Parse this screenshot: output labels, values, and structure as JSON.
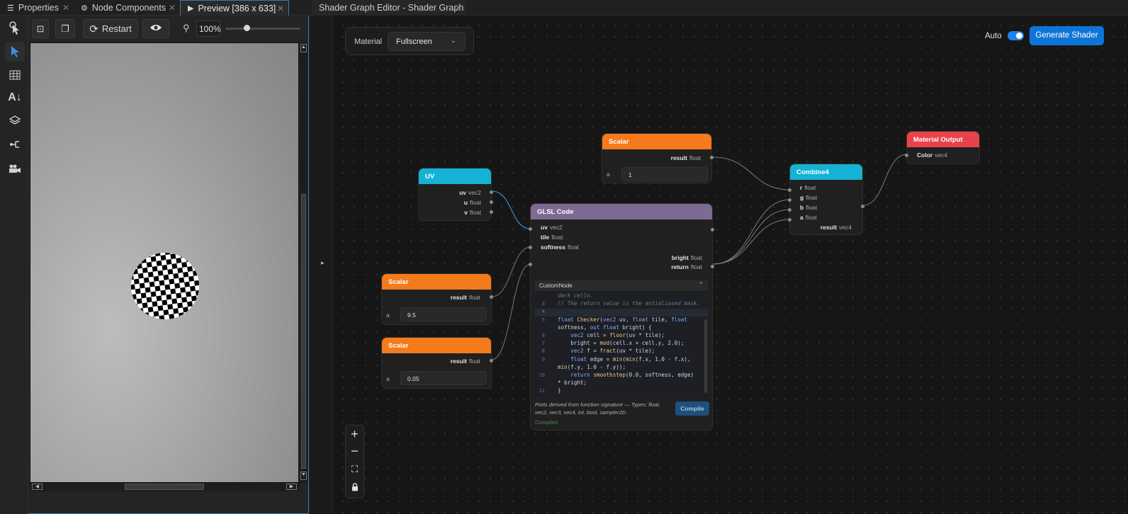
{
  "tabs": [
    {
      "label": "Properties"
    },
    {
      "label": "Node Components"
    },
    {
      "label": "Preview [386 x 633]"
    },
    {
      "label": "Shader Graph Editor - Shader Graph"
    }
  ],
  "preview": {
    "restart_label": "Restart",
    "zoom": "100%",
    "zoom_level": 0.28
  },
  "graph": {
    "material_label": "Material",
    "material_value": "Fullscreen",
    "auto_label": "Auto",
    "auto_on": true,
    "generate_label": "Generate Shader",
    "collapse_arrow": "▸"
  },
  "nodes": {
    "uv": {
      "title": "UV",
      "ports": [
        [
          "uv",
          "vec2"
        ],
        [
          "u",
          "float"
        ],
        [
          "v",
          "float"
        ]
      ]
    },
    "scalar_top": {
      "title": "Scalar",
      "out": [
        "result",
        "float"
      ],
      "field_label": "a",
      "value": "1"
    },
    "scalar_mid": {
      "title": "Scalar",
      "out": [
        "result",
        "float"
      ],
      "field_label": "a",
      "value": "9.5"
    },
    "scalar_bot": {
      "title": "Scalar",
      "out": [
        "result",
        "float"
      ],
      "field_label": "a",
      "value": "0.05"
    },
    "glsl": {
      "title": "GLSL Code",
      "inputs": [
        [
          "uv",
          "vec2"
        ],
        [
          "tile",
          "float"
        ],
        [
          "softness",
          "float"
        ]
      ],
      "outputs": [
        [
          "bright",
          "float"
        ],
        [
          "return",
          "float"
        ]
      ],
      "editor_name": "CustomNode",
      "code_lines": [
        {
          "n": "",
          "text": "dark cells."
        },
        {
          "n": "3",
          "text": "// The return value is the antialiased mask."
        },
        {
          "n": "4",
          "text": ""
        },
        {
          "n": "5",
          "text": "float Checker(vec2 uv, float tile, float"
        },
        {
          "n": "",
          "text": "softness, out float bright) {"
        },
        {
          "n": "6",
          "text": "    vec2 cell = floor(uv * tile);"
        },
        {
          "n": "7",
          "text": "    bright = mod(cell.x + cell.y, 2.0);"
        },
        {
          "n": "8",
          "text": "    vec2 f = fract(uv * tile);"
        },
        {
          "n": "9",
          "text": "    float edge = min(min(f.x, 1.0 - f.x),"
        },
        {
          "n": "",
          "text": "min(f.y, 1.0 - f.y));"
        },
        {
          "n": "10",
          "text": "    return smoothstep(0.0, softness, edge)"
        },
        {
          "n": "",
          "text": "* bright;"
        },
        {
          "n": "11",
          "text": "}"
        }
      ],
      "hint": "Ports derived from function signature — Types: float, vec2, vec3, vec4, int, bool, sampler2D",
      "compile_label": "Compile",
      "status": "Compiled"
    },
    "combine": {
      "title": "Combine4",
      "inputs": [
        [
          "r",
          "float"
        ],
        [
          "g",
          "float"
        ],
        [
          "b",
          "float"
        ],
        [
          "a",
          "float"
        ]
      ],
      "out": [
        "result",
        "vec4"
      ]
    },
    "output": {
      "title": "Material Output",
      "inputs": [
        [
          "Color",
          "vec4"
        ]
      ]
    }
  },
  "colors": {
    "accent": "#0e74d8",
    "orange": "#f57a1c",
    "cyan": "#14b2d4",
    "purple": "#7e6b94",
    "red": "#e8434a"
  }
}
